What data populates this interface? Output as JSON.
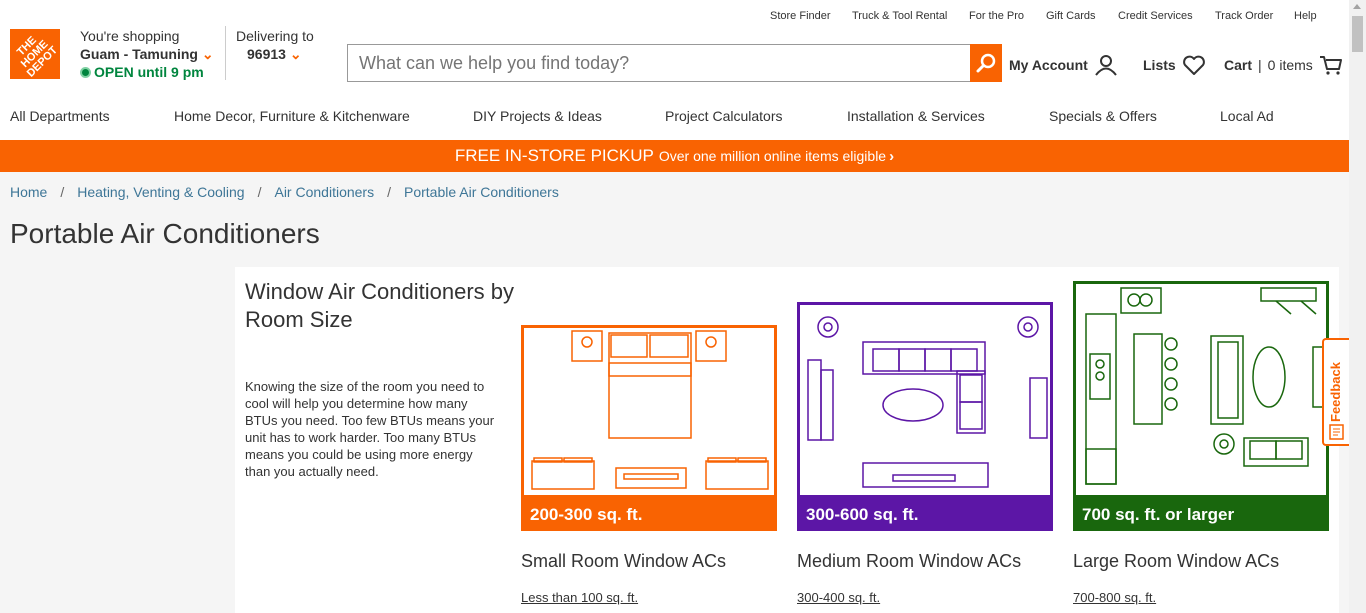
{
  "logo": {
    "text": "THE HOME DEPOT"
  },
  "store": {
    "label": "You're shopping",
    "name": "Guam - Tamuning",
    "status": "OPEN",
    "hours": "until 9 pm"
  },
  "delivery": {
    "label": "Delivering to",
    "zip": "96913"
  },
  "utility_links": [
    "Store Finder",
    "Truck & Tool Rental",
    "For the Pro",
    "Gift Cards",
    "Credit Services",
    "Track Order",
    "Help"
  ],
  "search": {
    "placeholder": "What can we help you find today?"
  },
  "account": {
    "my_account": "My Account",
    "lists": "Lists",
    "cart": "Cart",
    "cart_count": "0 items"
  },
  "nav": [
    "All Departments",
    "Home Decor, Furniture & Kitchenware",
    "DIY Projects & Ideas",
    "Project Calculators",
    "Installation & Services",
    "Specials & Offers",
    "Local Ad"
  ],
  "promo": {
    "headline": "FREE IN-STORE PICKUP",
    "sub": "Over one million online items eligible"
  },
  "breadcrumb": [
    "Home",
    "Heating, Venting & Cooling",
    "Air Conditioners",
    "Portable Air Conditioners"
  ],
  "page_title": "Portable Air Conditioners",
  "panel": {
    "title": "Window Air Conditioners by Room Size",
    "description": "Knowing the size of the room you need to cool will help you determine how many BTUs you need. Too few BTUs means your unit has to work harder. Too many BTUs means you could be using more energy than you actually need."
  },
  "cards": [
    {
      "band": "200-300 sq. ft.",
      "name": "Small Room Window ACs",
      "link": "Less than 100 sq. ft.",
      "color": "#f96302"
    },
    {
      "band": "300-600 sq. ft.",
      "name": "Medium Room Window ACs",
      "link": "300-400 sq. ft.",
      "color": "#5c16a6"
    },
    {
      "band": "700 sq. ft. or larger",
      "name": "Large Room Window ACs",
      "link": "700-800 sq. ft.",
      "color": "#19670d"
    }
  ],
  "feedback": {
    "label": "Feedback"
  }
}
